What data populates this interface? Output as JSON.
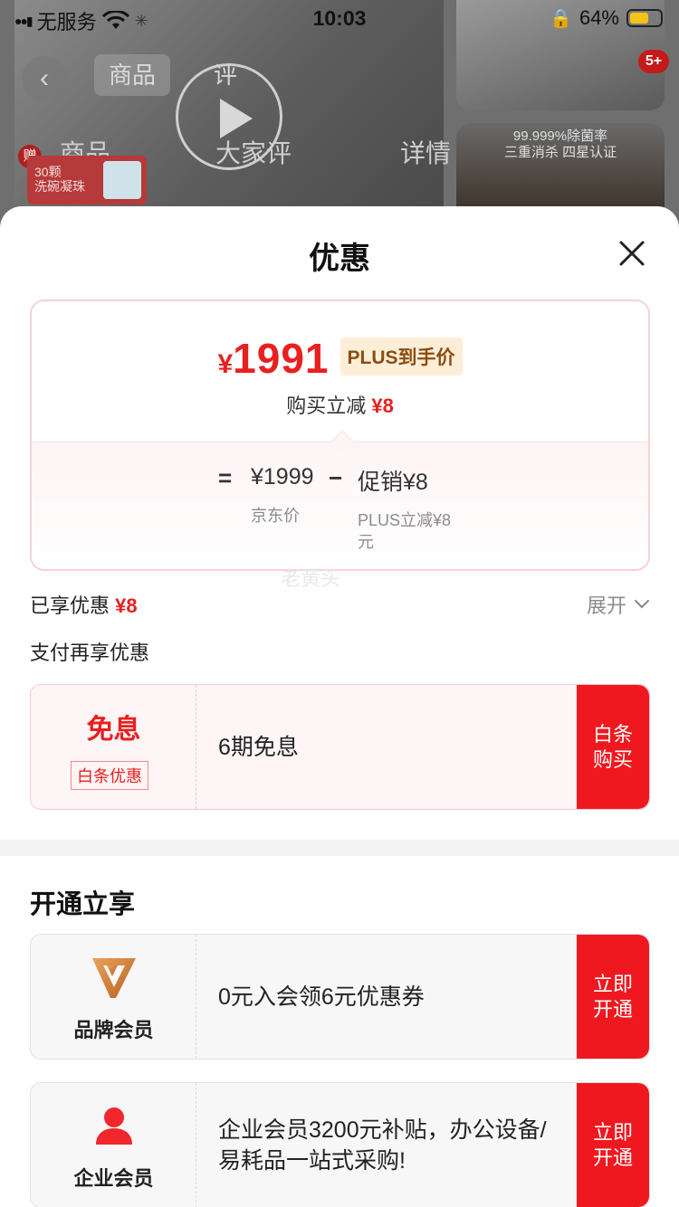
{
  "status_bar": {
    "carrier": "无服务",
    "time": "10:03",
    "battery": "64%"
  },
  "background": {
    "nav_tabs_top": [
      "商品",
      "评"
    ],
    "tabs": [
      "商品",
      "大家评",
      "详情"
    ],
    "gift_label": "赠",
    "promo_lines": [
      "30颗",
      "洗碗凝珠"
    ],
    "badge": "5+",
    "side_text": [
      "99.999%除菌率",
      "三重消杀 四星认证"
    ]
  },
  "sheet": {
    "title": "优惠",
    "price_card": {
      "currency": "¥",
      "price": "1991",
      "plus_tag": "PLUS到手价",
      "reduce_label": "购买立减",
      "reduce_value": "¥8",
      "equals": "=",
      "minus": "−",
      "base_value": "¥1999",
      "base_label": "京东价",
      "promo_value": "促销¥8",
      "promo_label": "PLUS立减¥8元"
    },
    "watermark": "老黄头",
    "saved": {
      "label": "已享优惠",
      "value": "¥8",
      "expand_label": "展开"
    },
    "pay_section_label": "支付再享优惠",
    "baitiao": {
      "title": "免息",
      "tag": "白条优惠",
      "desc": "6期免息",
      "button": "白条购买"
    },
    "open_section_title": "开通立享",
    "members": [
      {
        "name": "品牌会员",
        "icon": "brand-v-icon",
        "desc": "0元入会领6元优惠券",
        "button": "立即开通"
      },
      {
        "name": "企业会员",
        "icon": "person-icon",
        "desc": "企业会员3200元补贴，办公设备/易耗品一站式采购!",
        "button": "立即开通"
      }
    ]
  },
  "colors": {
    "accent_red": "#e8201f",
    "button_red": "#f0181f",
    "plus_tag_bg": "#fdeed8",
    "plus_tag_text": "#8a4d10"
  }
}
